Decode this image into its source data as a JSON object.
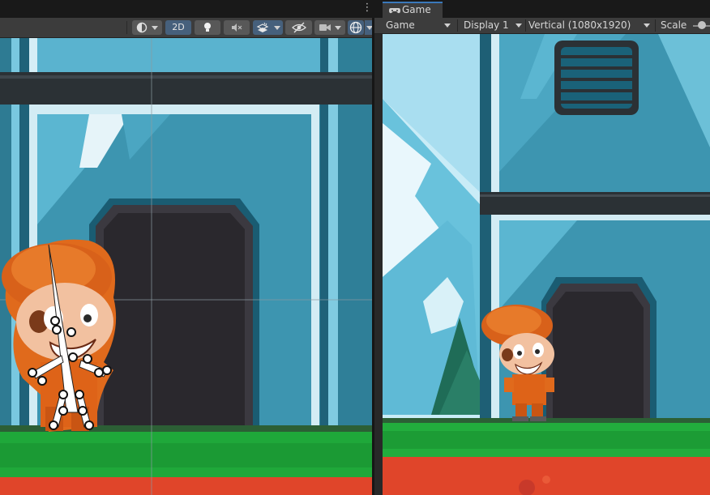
{
  "scene": {
    "more_glyph": "⋮",
    "toolbar": {
      "draw_mode_icon": "shading-mode-icon",
      "toggle_2d_label": "2D",
      "lighting_icon": "lightbulb-icon",
      "audio_icon": "audio-mute-icon",
      "effects_icon": "effects-icon",
      "visibility_icon": "eye-slash-icon",
      "camera_icon": "camera-icon",
      "gizmos_icon": "gizmo-globe-icon"
    }
  },
  "game": {
    "tab_label": "Game",
    "tab_icon": "gamepad-icon",
    "toolbar": {
      "mode_selected": "Game",
      "display_selected": "Display 1",
      "aspect_selected": "Vertical (1080x1920)",
      "scale_label": "Scale"
    }
  },
  "colors": {
    "editor_bg": "#1e1e1e",
    "toolbar_bg": "#3c3c3c",
    "active_button": "#46607c",
    "tab_accent": "#3a79bb",
    "building_teal": "#3c8ea6",
    "grass_green": "#1fa83a",
    "dirt_red": "#e0452a",
    "character_orange": "#e06a1c"
  }
}
